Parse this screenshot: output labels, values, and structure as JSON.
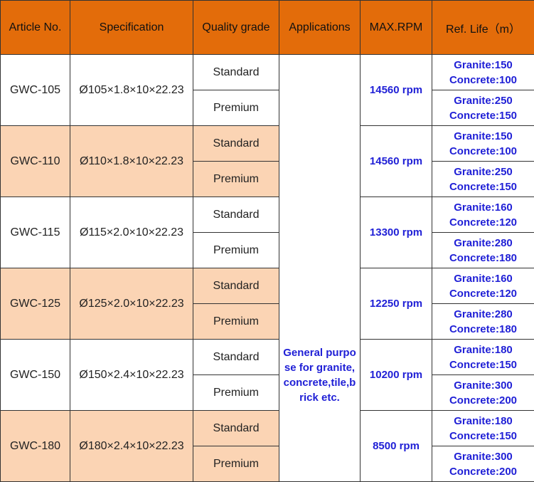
{
  "headers": [
    "Article No.",
    "Specification",
    "Quality grade",
    "Applications",
    "MAX.RPM",
    "Ref. Life（m）"
  ],
  "application": "General purpose for granite,concrete,tile,brick etc.",
  "rows": [
    {
      "article": "GWC-105",
      "spec": "Ø105×1.8×10×22.23",
      "rpm": "14560 rpm",
      "grades": [
        {
          "grade": "Standard",
          "granite": "Granite:150",
          "concrete": "Concrete:100"
        },
        {
          "grade": "Premium",
          "granite": "Granite:250",
          "concrete": "Concrete:150"
        }
      ]
    },
    {
      "article": "GWC-110",
      "spec": "Ø110×1.8×10×22.23",
      "rpm": "14560 rpm",
      "grades": [
        {
          "grade": "Standard",
          "granite": "Granite:150",
          "concrete": "Concrete:100"
        },
        {
          "grade": "Premium",
          "granite": "Granite:250",
          "concrete": "Concrete:150"
        }
      ]
    },
    {
      "article": "GWC-115",
      "spec": "Ø115×2.0×10×22.23",
      "rpm": "13300 rpm",
      "grades": [
        {
          "grade": "Standard",
          "granite": "Granite:160",
          "concrete": "Concrete:120"
        },
        {
          "grade": "Premium",
          "granite": "Granite:280",
          "concrete": "Concrete:180"
        }
      ]
    },
    {
      "article": "GWC-125",
      "spec": "Ø125×2.0×10×22.23",
      "rpm": "12250 rpm",
      "grades": [
        {
          "grade": "Standard",
          "granite": "Granite:160",
          "concrete": "Concrete:120"
        },
        {
          "grade": "Premium",
          "granite": "Granite:280",
          "concrete": "Concrete:180"
        }
      ]
    },
    {
      "article": "GWC-150",
      "spec": "Ø150×2.4×10×22.23",
      "rpm": "10200 rpm",
      "grades": [
        {
          "grade": "Standard",
          "granite": "Granite:180",
          "concrete": "Concrete:150"
        },
        {
          "grade": "Premium",
          "granite": "Granite:300",
          "concrete": "Concrete:200"
        }
      ]
    },
    {
      "article": "GWC-180",
      "spec": "Ø180×2.4×10×22.23",
      "rpm": "8500 rpm",
      "grades": [
        {
          "grade": "Standard",
          "granite": "Granite:180",
          "concrete": "Concrete:150"
        },
        {
          "grade": "Premium",
          "granite": "Granite:300",
          "concrete": "Concrete:200"
        }
      ]
    }
  ],
  "colors": {
    "header_bg": "#e36c0a",
    "band_bg": "#fbd4b4",
    "value_text": "#1f1fd6"
  }
}
